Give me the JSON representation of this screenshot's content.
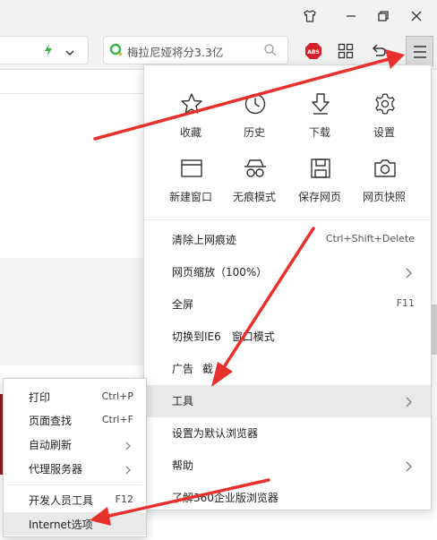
{
  "toolbar": {
    "search_text": "梅拉尼娅将分3.3亿",
    "adblock_label": "ABS"
  },
  "menu": {
    "grid": [
      {
        "label": "收藏",
        "icon": "star-icon"
      },
      {
        "label": "历史",
        "icon": "clock-icon"
      },
      {
        "label": "下载",
        "icon": "download-icon"
      },
      {
        "label": "设置",
        "icon": "gear-icon"
      },
      {
        "label": "新建窗口",
        "icon": "window-icon"
      },
      {
        "label": "无痕模式",
        "icon": "incognito-icon"
      },
      {
        "label": "保存网页",
        "icon": "save-icon"
      },
      {
        "label": "网页快照",
        "icon": "camera-icon"
      }
    ],
    "items": [
      {
        "label": "清除上网痕迹",
        "shortcut": "Ctrl+Shift+Delete"
      },
      {
        "label": "网页缩放（100%）",
        "shortcut": ""
      },
      {
        "label": "全屏",
        "shortcut": "F11"
      },
      {
        "label": "切换到IE6",
        "label_tail": "窗口模式",
        "shortcut": ""
      },
      {
        "label": "广告",
        "label_tail": "截",
        "shortcut": ""
      },
      {
        "label": "工具",
        "shortcut": ""
      },
      {
        "label": "设置为默认浏览器",
        "shortcut": ""
      },
      {
        "label": "帮助",
        "shortcut": ""
      },
      {
        "label": "了解360企业版浏览器",
        "shortcut": ""
      }
    ]
  },
  "submenu": {
    "items": [
      {
        "label": "打印",
        "shortcut": "Ctrl+P"
      },
      {
        "label": "页面查找",
        "shortcut": "Ctrl+F"
      },
      {
        "label": "自动刷新",
        "shortcut": ""
      },
      {
        "label": "代理服务器",
        "shortcut": ""
      },
      {
        "label": "开发人员工具",
        "shortcut": "F12"
      },
      {
        "label": "Internet选项",
        "shortcut": ""
      }
    ]
  },
  "colors": {
    "arrow": "#e8302c",
    "highlight": "#e9e9e9",
    "lightning": "#3bb54a",
    "adblock": "#d3232a"
  }
}
